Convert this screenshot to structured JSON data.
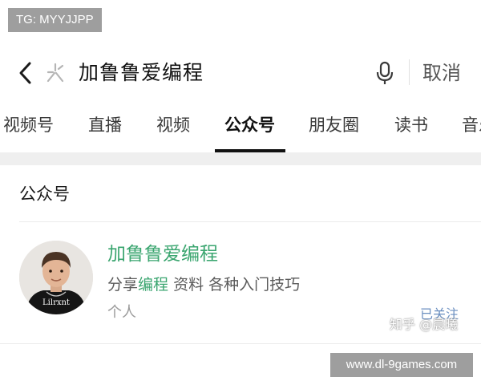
{
  "watermark_top_left": "TG: MYYJJPP",
  "search": {
    "query": "加鲁鲁爱编程",
    "cancel_label": "取消",
    "icons": {
      "back": "back-arrow-icon",
      "mini": "mini-program-icon",
      "voice": "microphone-icon"
    }
  },
  "tabs": [
    {
      "label": "视频号"
    },
    {
      "label": "直播"
    },
    {
      "label": "视频"
    },
    {
      "label": "公众号",
      "active": true
    },
    {
      "label": "朋友圈"
    },
    {
      "label": "读书"
    },
    {
      "label": "音乐"
    }
  ],
  "section": {
    "title": "公众号"
  },
  "result": {
    "name": "加鲁鲁爱编程",
    "desc_prefix": "分享",
    "desc_highlight": "编程",
    "desc_suffix": " 资料 各种入门技巧",
    "account_type": "个人",
    "follow_status": "已关注",
    "avatar_shirt_text": "Lilrxnt"
  },
  "watermarks": {
    "zhihu": "知乎 @晨曦",
    "site": "www.dl-9games.com"
  },
  "colors": {
    "highlight_green": "#3aa56f",
    "follow_blue": "#6b8fc0",
    "divider_gray": "#efefef"
  }
}
